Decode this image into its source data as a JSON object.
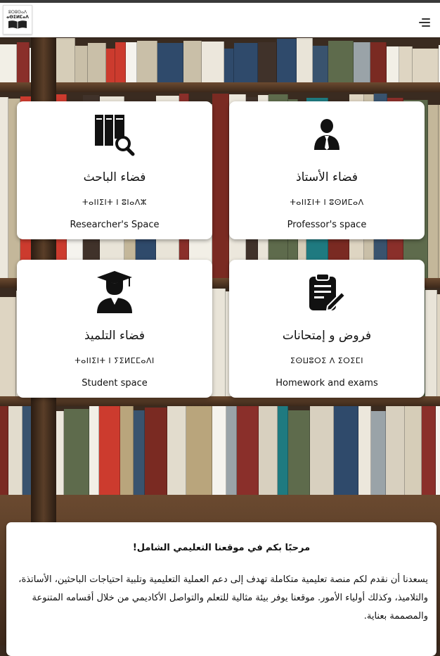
{
  "header": {
    "logo_line1": "ⵓⵔⵓⵙⴰⴷ",
    "logo_line2": "ⴰⵙⵉⵍⵎⴰⴷ",
    "menu_icon": "hamburger-menu-icon"
  },
  "cards": [
    {
      "ar": "فضاء الباحث",
      "tz": "ⵜⴰⵏⵏⵉⵏⵜ ⵏ ⵓⵏⴰⴷⵣ",
      "en": "Researcher's Space",
      "icon": "book-search-icon"
    },
    {
      "ar": "فضاء الأستاذ",
      "tz": "ⵜⴰⵏⵏⵉⵏⵜ ⵏ ⵓⵙⵍⵎⴰⴷ",
      "en": "Professor's space",
      "icon": "person-tie-icon"
    },
    {
      "ar": "فضاء التلميذ",
      "tz": "ⵜⴰⵏⵏⵉⵏⵜ ⵏ ⵢⵉⵍⵎⵎⴰⴷⵏ",
      "en": "Student space",
      "icon": "graduate-icon"
    },
    {
      "ar": "فروض و إمتحانات",
      "tz": "ⵉⵙⵡⵓⵔⵉ ⴷ ⵉⵔⵉⵎⵏ",
      "en": "Homework and exams",
      "icon": "clipboard-edit-icon"
    }
  ],
  "welcome": {
    "title": "مرحبًا بكم في موقعنا التعليمي الشامل!",
    "body": "يسعدنا أن نقدم لكم منصة تعليمية متكاملة تهدف إلى دعم العملية التعليمية وتلبية احتياجات الباحثين، الأساتذة، والتلاميذ، وكذلك أولياء الأمور. موقعنا يوفر بيئة مثالية للتعلم والتواصل الأكاديمي من خلال أقسامه المتنوعة والمصممة بعناية."
  }
}
